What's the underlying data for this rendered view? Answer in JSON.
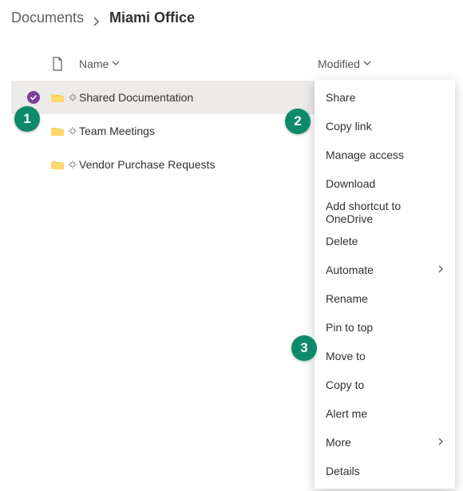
{
  "breadcrumb": {
    "root": "Documents",
    "current": "Miami Office"
  },
  "columns": {
    "name": "Name",
    "modified": "Modified"
  },
  "rows": [
    {
      "name": "Shared Documentation",
      "selected": true,
      "showActions": true
    },
    {
      "name": "Team Meetings",
      "selected": false,
      "showActions": false
    },
    {
      "name": "Vendor Purchase Requests",
      "selected": false,
      "showActions": false
    }
  ],
  "menu": {
    "items": [
      {
        "label": "Share",
        "submenu": false
      },
      {
        "label": "Copy link",
        "submenu": false
      },
      {
        "label": "Manage access",
        "submenu": false
      },
      {
        "label": "Download",
        "submenu": false
      },
      {
        "label": "Add shortcut to OneDrive",
        "submenu": false
      },
      {
        "label": "Delete",
        "submenu": false
      },
      {
        "label": "Automate",
        "submenu": true
      },
      {
        "label": "Rename",
        "submenu": false
      },
      {
        "label": "Pin to top",
        "submenu": false
      },
      {
        "label": "Move to",
        "submenu": false
      },
      {
        "label": "Copy to",
        "submenu": false
      },
      {
        "label": "Alert me",
        "submenu": false
      },
      {
        "label": "More",
        "submenu": true
      },
      {
        "label": "Details",
        "submenu": false
      }
    ]
  },
  "callouts": {
    "c1": "1",
    "c2": "2",
    "c3": "3"
  }
}
